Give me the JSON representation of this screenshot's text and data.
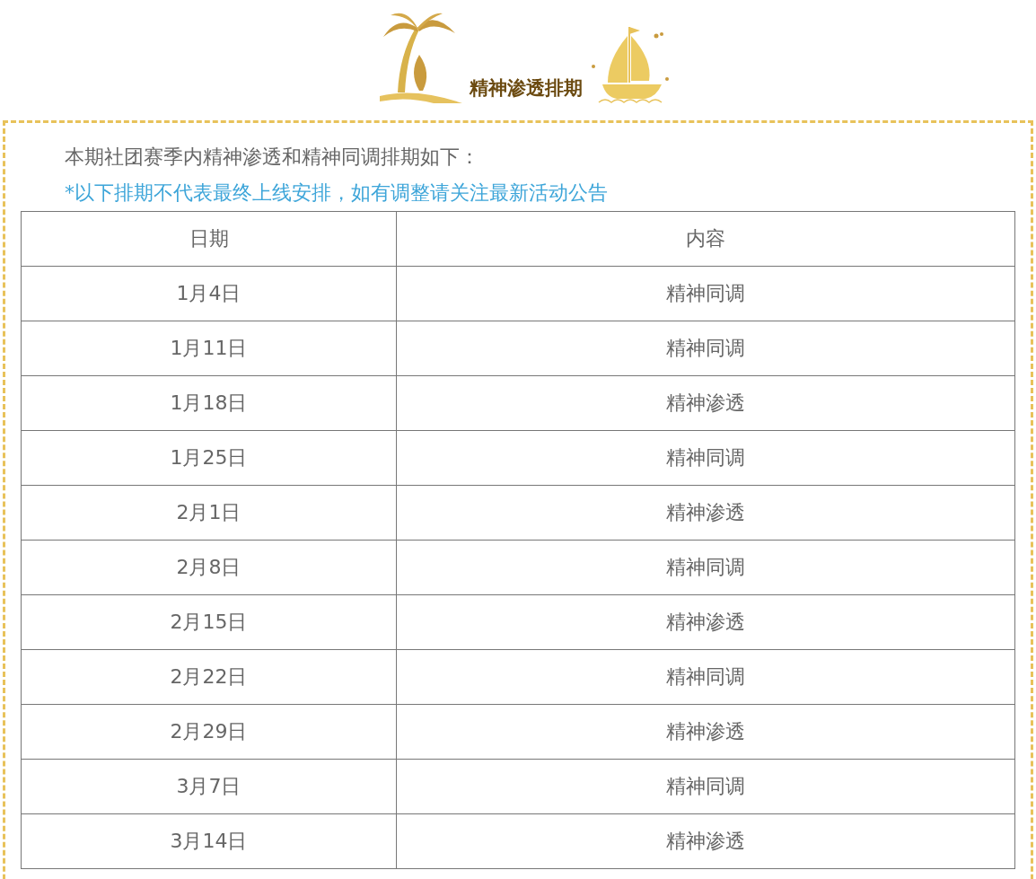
{
  "header": {
    "title": "精神渗透排期"
  },
  "intro": "本期社团赛季内精神渗透和精神同调排期如下：",
  "note": "*以下排期不代表最终上线安排，如有调整请关注最新活动公告",
  "table": {
    "columns": [
      "日期",
      "内容"
    ],
    "rows": [
      [
        "1月4日",
        "精神同调"
      ],
      [
        "1月11日",
        "精神同调"
      ],
      [
        "1月18日",
        "精神渗透"
      ],
      [
        "1月25日",
        "精神同调"
      ],
      [
        "2月1日",
        "精神渗透"
      ],
      [
        "2月8日",
        "精神同调"
      ],
      [
        "2月15日",
        "精神渗透"
      ],
      [
        "2月22日",
        "精神同调"
      ],
      [
        "2月29日",
        "精神渗透"
      ],
      [
        "3月7日",
        "精神同调"
      ],
      [
        "3月14日",
        "精神渗透"
      ]
    ]
  }
}
